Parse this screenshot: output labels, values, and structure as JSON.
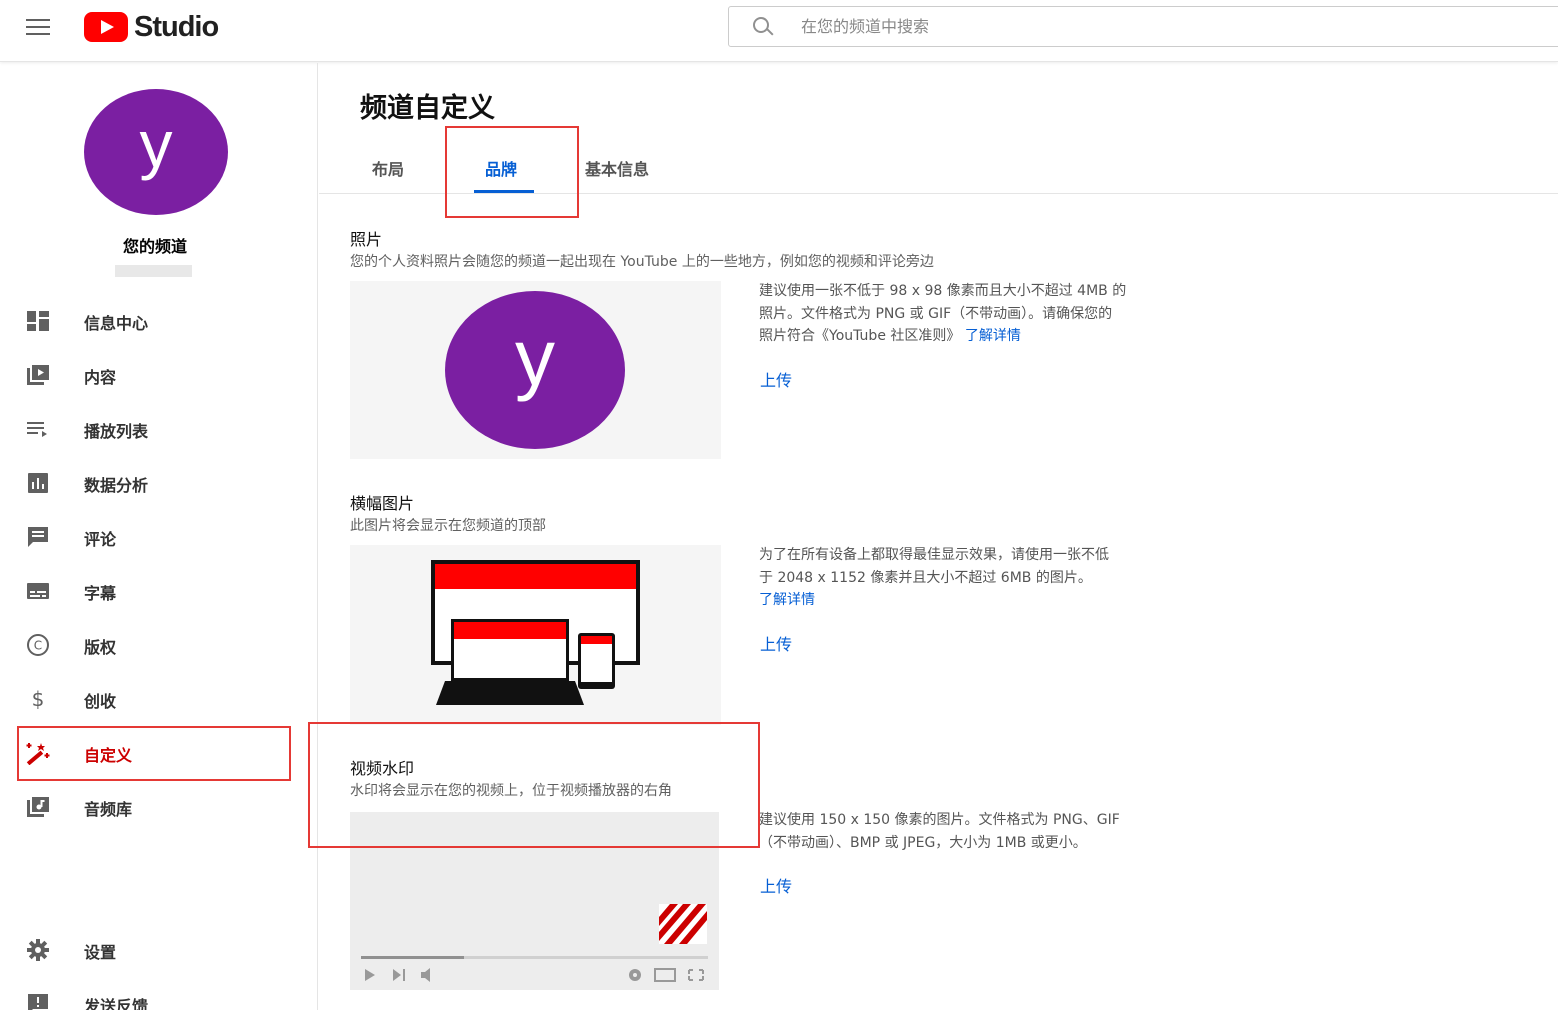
{
  "header": {
    "logo_text": "Studio",
    "search_placeholder": "在您的频道中搜索"
  },
  "sidebar": {
    "avatar_letter": "y",
    "channel_name": "您的频道",
    "items": [
      {
        "label": "信息中心",
        "icon": "dashboard-icon"
      },
      {
        "label": "内容",
        "icon": "video-library-icon"
      },
      {
        "label": "播放列表",
        "icon": "playlist-icon"
      },
      {
        "label": "数据分析",
        "icon": "analytics-icon"
      },
      {
        "label": "评论",
        "icon": "comment-icon"
      },
      {
        "label": "字幕",
        "icon": "subtitles-icon"
      },
      {
        "label": "版权",
        "icon": "copyright-icon"
      },
      {
        "label": "创收",
        "icon": "dollar-icon"
      },
      {
        "label": "自定义",
        "icon": "magic-wand-icon",
        "active": true
      },
      {
        "label": "音频库",
        "icon": "audio-library-icon"
      }
    ],
    "bottom_items": [
      {
        "label": "设置",
        "icon": "gear-icon"
      },
      {
        "label": "发送反馈",
        "icon": "feedback-icon"
      }
    ]
  },
  "main": {
    "title": "频道自定义",
    "tabs": [
      {
        "label": "布局"
      },
      {
        "label": "品牌",
        "active": true
      },
      {
        "label": "基本信息"
      }
    ],
    "photo": {
      "title": "照片",
      "desc": "您的个人资料照片会随您的频道一起出现在 YouTube 上的一些地方，例如您的视频和评论旁边",
      "avatar_letter": "y",
      "info_line1": "建议使用一张不低于 98 x 98 像素而且大小不超过 4MB 的",
      "info_line2": "照片。文件格式为 PNG 或 GIF（不带动画）。请确保您的",
      "info_line3": "照片符合《YouTube 社区准则》",
      "learn_more": "了解详情",
      "upload": "上传"
    },
    "banner": {
      "title": "横幅图片",
      "desc": "此图片将会显示在您频道的顶部",
      "info_line1": "为了在所有设备上都取得最佳显示效果，请使用一张不低",
      "info_line2": "于 2048 x 1152 像素并且大小不超过 6MB 的图片。",
      "learn_more": "了解详情",
      "upload": "上传"
    },
    "watermark": {
      "title": "视频水印",
      "desc": "水印将会显示在您的视频上，位于视频播放器的右角",
      "info_line1": "建议使用 150 x 150 像素的图片。文件格式为 PNG、GIF",
      "info_line2": "（不带动画）、BMP 或 JPEG，大小为 1MB 或更小。",
      "upload": "上传"
    }
  },
  "colors": {
    "accent": "#065fd4",
    "brand_red": "#ff0000",
    "avatar_purple": "#7b1fa2",
    "highlight_red": "#e53935"
  }
}
